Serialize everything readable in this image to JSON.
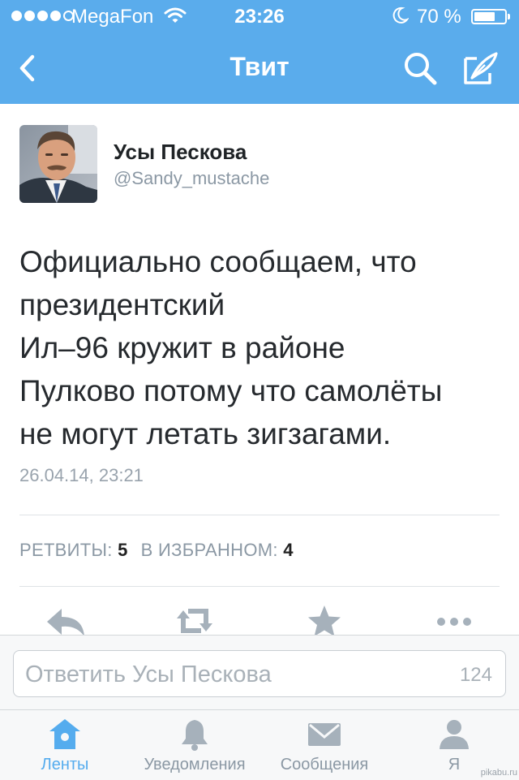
{
  "status_bar": {
    "carrier": "MegaFon",
    "time": "23:26",
    "battery_percent": "70 %",
    "signal_level": 4,
    "battery_level": 0.7,
    "icons": [
      "signal-dots-icon",
      "wifi-icon",
      "moon-icon",
      "battery-icon"
    ]
  },
  "nav": {
    "title": "Твит",
    "icons": [
      "back-chevron-icon",
      "search-icon",
      "compose-icon"
    ]
  },
  "tweet": {
    "author_name": "Усы Пескова",
    "author_handle": "@Sandy_mustache",
    "lines": [
      "Официально сообщаем, что",
      "президентский",
      "Ил–96 кружит в районе",
      "Пулково потому что самолёты",
      "не могут летать зигзагами."
    ],
    "date": "26.04.14, 23:21",
    "retweets_label": "РЕТВИТЫ:",
    "retweets_count": "5",
    "favorites_label": "В ИЗБРАННОМ:",
    "favorites_count": "4"
  },
  "actions": [
    "reply-icon",
    "retweet-icon",
    "favorite-star-icon",
    "more-dots-icon"
  ],
  "reply": {
    "placeholder": "Ответить Усы Пескова",
    "char_count": "124"
  },
  "tabs": [
    {
      "label": "Ленты",
      "icon": "home-icon",
      "active": true
    },
    {
      "label": "Уведомления",
      "icon": "bell-icon",
      "active": false
    },
    {
      "label": "Сообщения",
      "icon": "envelope-icon",
      "active": false
    },
    {
      "label": "Я",
      "icon": "person-icon",
      "active": false
    }
  ],
  "watermark": "pikabu.ru",
  "colors": {
    "accent": "#5aacec",
    "action_gray": "#a6b1bb",
    "text": "#262a2e",
    "muted": "#8b98a4"
  }
}
